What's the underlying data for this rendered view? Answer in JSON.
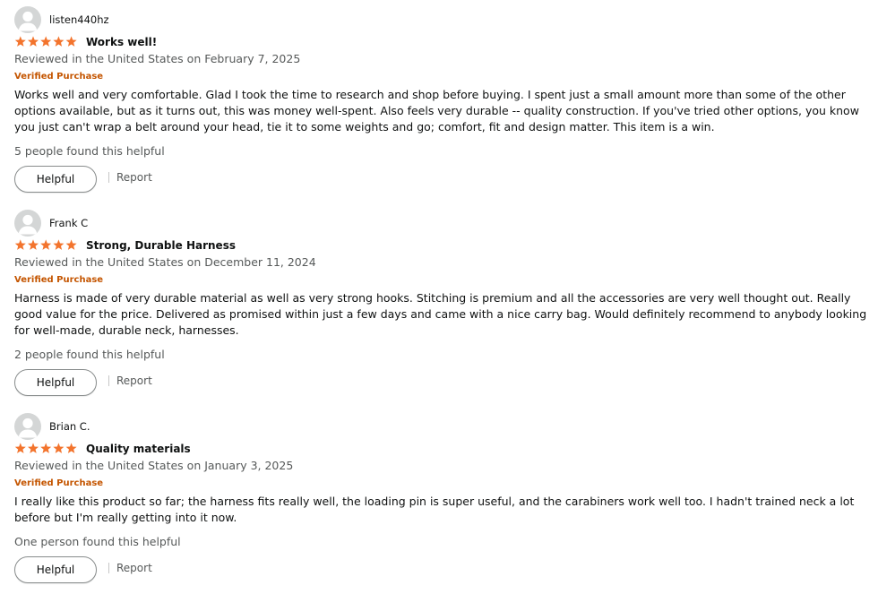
{
  "colors": {
    "star": "#f3742d",
    "verified": "#c45500",
    "secondary_text": "#565959",
    "primary_text": "#0f1111"
  },
  "reviews": [
    {
      "profile_name": "listen440hz",
      "rating": 5,
      "title": "Works well!",
      "date": "Reviewed in the United States on February 7, 2025",
      "verified": "Verified Purchase",
      "body": "Works well and very comfortable. Glad I took the time to research and shop before buying. I spent just a small amount more than some of the other options available, but as it turns out, this was money well-spent. Also feels very durable -- quality construction. If you've tried other options, you know you just can't wrap a belt around your head, tie it to some weights and go; comfort, fit and design matter. This item is a win.",
      "helpful_count": "5 people found this helpful",
      "helpful_button": "Helpful",
      "report_label": "Report"
    },
    {
      "profile_name": "Frank C",
      "rating": 5,
      "title": "Strong, Durable Harness",
      "date": "Reviewed in the United States on December 11, 2024",
      "verified": "Verified Purchase",
      "body": "Harness is made of very durable material as well as very strong hooks. Stitching is premium and all the accessories are very well thought out. Really good value for the price. Delivered as promised within just a few days and came with a nice carry bag. Would definitely recommend to anybody looking for well-made, durable neck, harnesses.",
      "helpful_count": "2 people found this helpful",
      "helpful_button": "Helpful",
      "report_label": "Report"
    },
    {
      "profile_name": "Brian C.",
      "rating": 5,
      "title": "Quality materials",
      "date": "Reviewed in the United States on January 3, 2025",
      "verified": "Verified Purchase",
      "body": "I really like this product so far; the harness fits really well, the loading pin is super useful, and the carabiners work well too. I hadn't trained neck a lot before but I'm really getting into it now.",
      "helpful_count": "One person found this helpful",
      "helpful_button": "Helpful",
      "report_label": "Report"
    }
  ]
}
